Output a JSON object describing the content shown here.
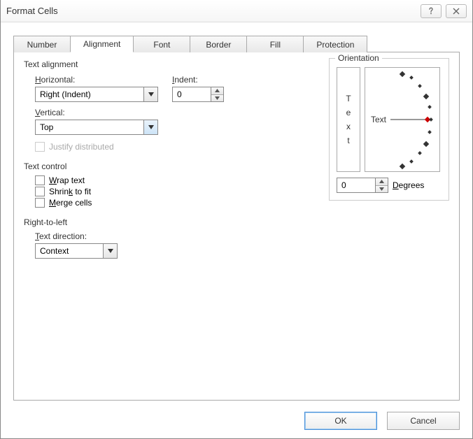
{
  "window": {
    "title": "Format Cells"
  },
  "tabs": {
    "number": "Number",
    "alignment": "Alignment",
    "font": "Font",
    "border": "Border",
    "fill": "Fill",
    "protection": "Protection"
  },
  "text_alignment": {
    "section": "Text alignment",
    "horizontal_label": "Horizontal:",
    "horizontal_value": "Right (Indent)",
    "vertical_label": "Vertical:",
    "vertical_value": "Top",
    "indent_label": "Indent:",
    "indent_value": "0",
    "justify_distributed": "Justify distributed"
  },
  "text_control": {
    "section": "Text control",
    "wrap": "Wrap text",
    "shrink": "Shrink to fit",
    "merge": "Merge cells"
  },
  "rtl": {
    "section": "Right-to-left",
    "direction_label": "Text direction:",
    "direction_value": "Context"
  },
  "orientation": {
    "section": "Orientation",
    "vertical_letters": [
      "T",
      "e",
      "x",
      "t"
    ],
    "dial_label": "Text",
    "degrees_value": "0",
    "degrees_label": "Degrees"
  },
  "buttons": {
    "ok": "OK",
    "cancel": "Cancel"
  }
}
